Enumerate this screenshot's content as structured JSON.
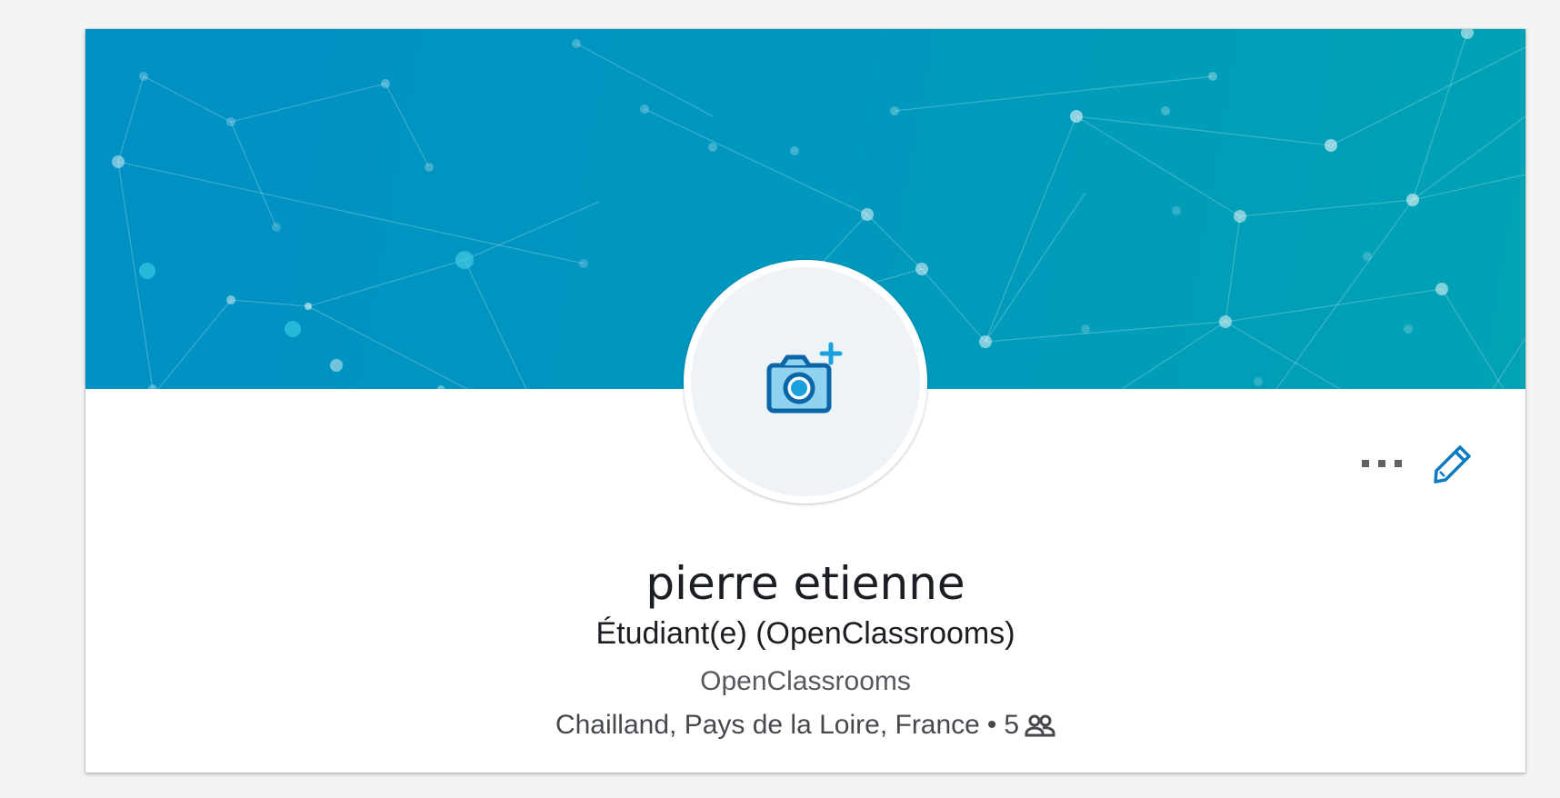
{
  "profile": {
    "name": "pierre etienne",
    "headline": "Étudiant(e) (OpenClassrooms)",
    "company": "OpenClassrooms",
    "location": "Chailland, Pays de la Loire, France",
    "separator": "•",
    "connections": "5"
  },
  "actions": {
    "more_label": "•••"
  },
  "icons": {
    "avatar": "camera-add-icon",
    "more": "more-icon",
    "edit": "pencil-icon",
    "connections": "people-icon"
  },
  "colors": {
    "banner_start": "#0090c4",
    "banner_end": "#00a2b4",
    "accent": "#0073b1",
    "camera_fill": "#68c7ec",
    "text_primary": "#1b1f23",
    "text_secondary": "#55595e"
  }
}
